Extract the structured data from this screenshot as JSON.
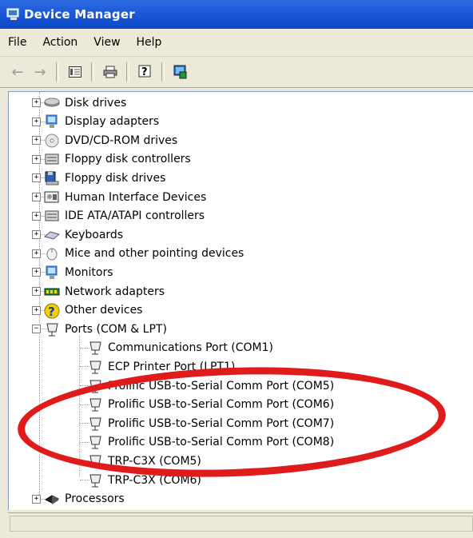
{
  "window": {
    "title": "Device Manager"
  },
  "menu": [
    "File",
    "Action",
    "View",
    "Help"
  ],
  "toolbar": [
    {
      "name": "back-arrow-icon",
      "glyph": "⇦"
    },
    {
      "name": "forward-arrow-icon",
      "glyph": "⇨"
    },
    {
      "name": "properties-icon",
      "glyph": "▣"
    },
    {
      "name": "print-icon",
      "glyph": "⎙"
    },
    {
      "name": "help-icon",
      "glyph": "?"
    },
    {
      "name": "scan-hardware-icon",
      "glyph": "▦"
    }
  ],
  "tree": {
    "categories": [
      {
        "label": "Disk drives",
        "icon": "disk-drive-icon",
        "expanded": false
      },
      {
        "label": "Display adapters",
        "icon": "display-adapter-icon",
        "expanded": false
      },
      {
        "label": "DVD/CD-ROM drives",
        "icon": "dvd-drive-icon",
        "expanded": false
      },
      {
        "label": "Floppy disk controllers",
        "icon": "floppy-controller-icon",
        "expanded": false
      },
      {
        "label": "Floppy disk drives",
        "icon": "floppy-drive-icon",
        "expanded": false
      },
      {
        "label": "Human Interface Devices",
        "icon": "hid-icon",
        "expanded": false
      },
      {
        "label": "IDE ATA/ATAPI controllers",
        "icon": "ide-controller-icon",
        "expanded": false
      },
      {
        "label": "Keyboards",
        "icon": "keyboard-icon",
        "expanded": false
      },
      {
        "label": "Mice and other pointing devices",
        "icon": "mouse-icon",
        "expanded": false
      },
      {
        "label": "Monitors",
        "icon": "monitor-icon",
        "expanded": false
      },
      {
        "label": "Network adapters",
        "icon": "network-adapter-icon",
        "expanded": false
      },
      {
        "label": "Other devices",
        "icon": "other-devices-icon",
        "expanded": false
      },
      {
        "label": "Ports (COM & LPT)",
        "icon": "port-icon",
        "expanded": true
      },
      {
        "label": "Processors",
        "icon": "processor-icon",
        "expanded": false
      }
    ],
    "ports": [
      "Communications Port (COM1)",
      "ECP Printer Port (LPT1)",
      "Prolific USB-to-Serial Comm Port (COM5)",
      "Prolific USB-to-Serial Comm Port (COM6)",
      "Prolific USB-to-Serial Comm Port (COM7)",
      "Prolific USB-to-Serial Comm Port (COM8)",
      "TRP-C3X (COM5)",
      "TRP-C3X (COM6)"
    ],
    "highlight_color": "#e01b1b"
  },
  "statusbar": {
    "text": ""
  }
}
